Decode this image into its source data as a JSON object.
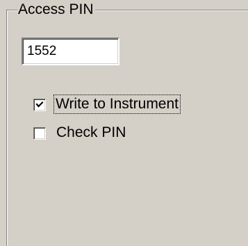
{
  "group": {
    "title": "Access PIN"
  },
  "pin": {
    "value": "1552"
  },
  "options": {
    "write_to_instrument": {
      "label": "Write to Instrument",
      "checked": true
    },
    "check_pin": {
      "label": "Check PIN",
      "checked": false
    }
  },
  "icons": {
    "checkmark": "check-icon"
  }
}
